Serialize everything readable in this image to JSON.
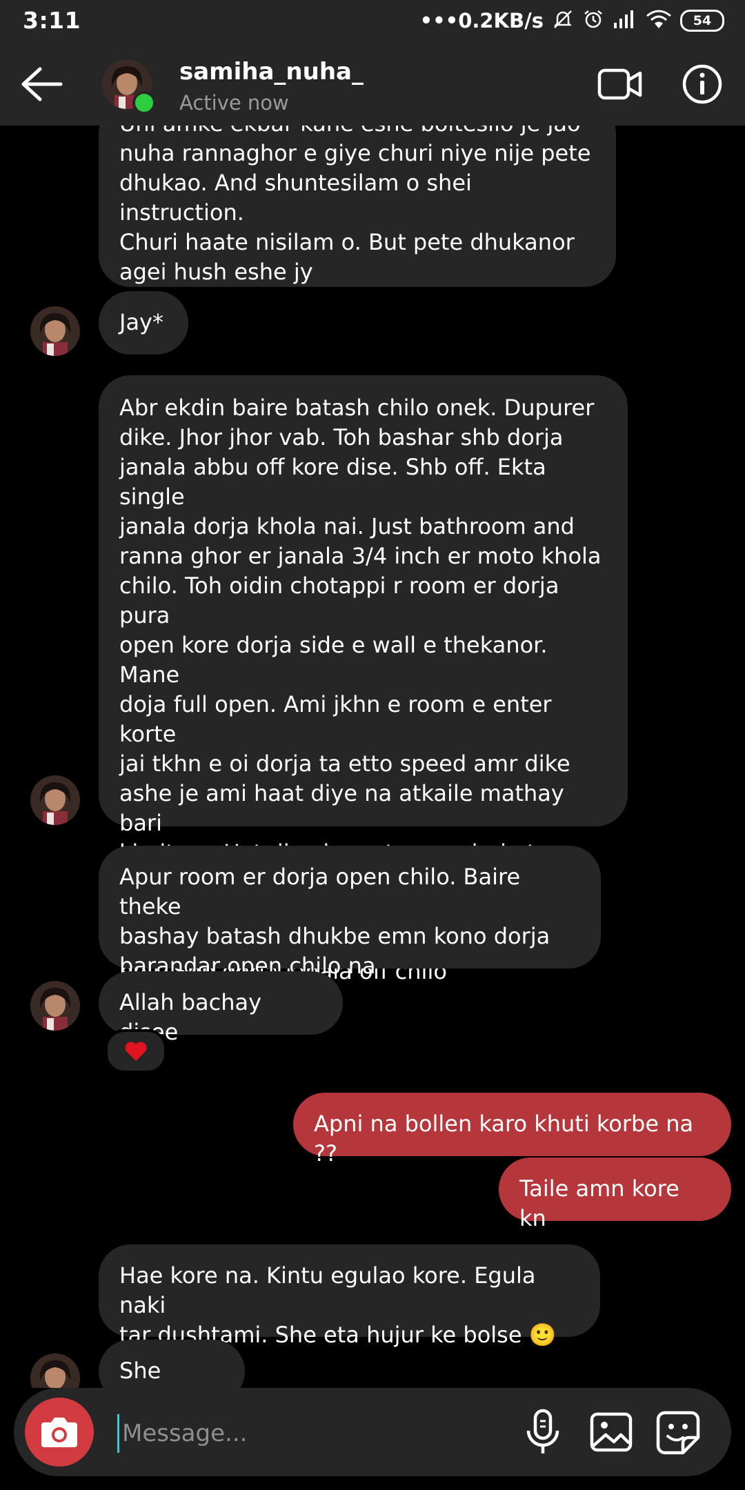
{
  "status_bar": {
    "time": "3:11",
    "dots": "•••",
    "net_speed": "0.2KB/s",
    "battery": "54"
  },
  "header": {
    "username": "samiha_nuha_",
    "status": "Active now"
  },
  "messages": [
    {
      "from": "them",
      "text": "Uni amke ekbar kane eshe boltesilo je jao\nnuha rannaghor e giye churi niye nije pete\ndhukao. And shuntesilam o shei instruction.\nChuri haate nisilam o. But pete dhukanor\nagei  hush eshe jy"
    },
    {
      "from": "them",
      "text": "Jay*"
    },
    {
      "from": "them",
      "text": "Abr ekdin baire batash chilo onek. Dupurer\ndike. Jhor jhor vab. Toh bashar shb dorja\njanala abbu off kore dise. Shb off. Ekta single\njanala dorja khola nai. Just bathroom and\nranna ghor er janala 3/4 inch er moto khola\nchilo. Toh oidin chotappi r room er dorja pura\nopen kore dorja side e wall e thekanor. Mane\ndoja full open. Ami jkhn e room e enter korte\njai tkhn e oi dorja ta etto speed amr dike\nashe je ami haat diye na atkaile mathay bari\nkhaitam. Hat diye jmne temne dorja ta dhore\nbeche gesilam oidin. Haat e betha paisilam\nonk. And dorja tar onek shokti chilo. Abro\nboli. Shb dorja janala off chilo"
    },
    {
      "from": "them",
      "text": "Apur room er dorja open chilo. Baire theke\nbashay batash dhukbe emn kono dorja\nbarandar open chilo na"
    },
    {
      "from": "them",
      "text": "Allah bachay disee"
    },
    {
      "from": "me",
      "text": "Apni na bollen karo khuti korbe na ??"
    },
    {
      "from": "me",
      "text": "Taile amn kore kn"
    },
    {
      "from": "them",
      "text": "Hae kore na. Kintu egulao kore. Egula naki\ntar dushtami. She eta hujur ke bolse 🙂"
    },
    {
      "from": "them",
      "text": "She khele"
    }
  ],
  "reaction": {
    "emoji": "heart"
  },
  "composer": {
    "placeholder": "Message..."
  },
  "colors": {
    "incoming_bubble": "#262626",
    "outgoing_bubble": "#b5373b",
    "camera_button": "#d23b3f",
    "online": "#2ecc40"
  }
}
